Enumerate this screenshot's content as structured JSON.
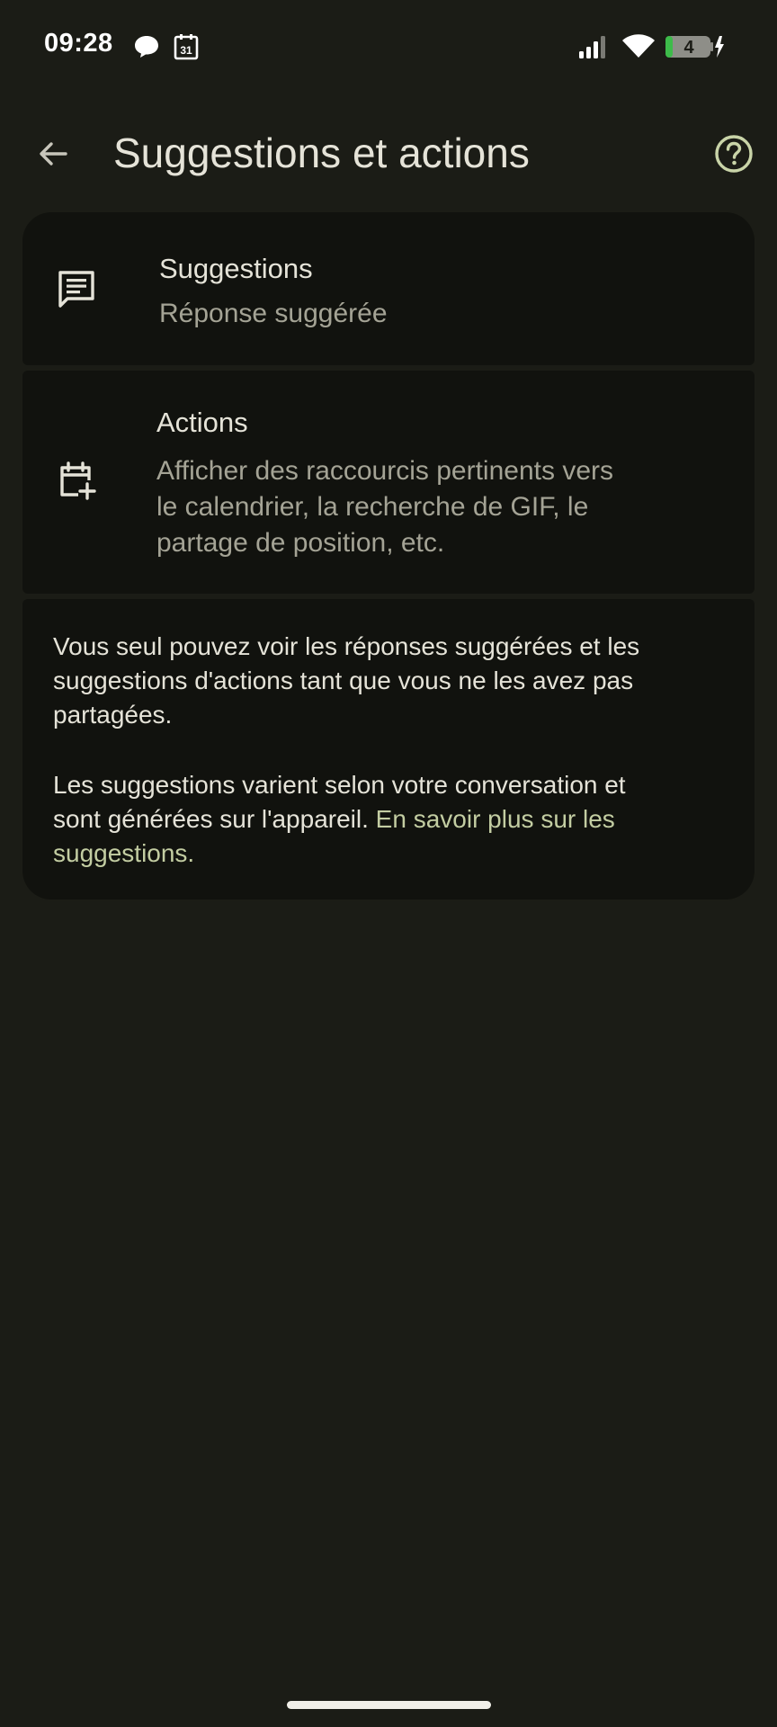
{
  "status_bar": {
    "time": "09:28",
    "battery_level": "4",
    "icons": [
      "chat-bubble-icon",
      "calendar-31-icon",
      "signal-icon",
      "wifi-icon",
      "battery-charging-icon"
    ],
    "calendar_day": "31"
  },
  "app_bar": {
    "title": "Suggestions et actions",
    "back_icon": "arrow-back-icon",
    "help_icon": "help-circle-icon"
  },
  "settings": {
    "suggestions": {
      "title": "Suggestions",
      "subtitle": "Réponse suggérée",
      "icon": "message-lines-icon"
    },
    "actions": {
      "title": "Actions",
      "subtitle_lines": [
        "Afficher des raccourcis pertinents vers",
        "le calendrier, la recherche de GIF, le",
        "partage de position, etc."
      ],
      "icon": "calendar-add-icon"
    }
  },
  "info": {
    "paragraph1_lines": [
      "Vous seul pouvez voir les réponses suggérées et les",
      "suggestions d'actions tant que vous ne les avez pas",
      "partagées."
    ],
    "paragraph2_line1": "Les suggestions varient selon votre conversation et",
    "paragraph2_line2_text": "sont générées sur l'appareil. ",
    "link_part1": "En savoir plus sur les",
    "link_part2": "suggestions."
  },
  "colors": {
    "background": "#1b1c16",
    "card": "#11120e",
    "text_primary": "#e5e3d8",
    "text_secondary": "#a4a395",
    "link": "#c3cda2",
    "help_icon": "#c9d4a8"
  }
}
